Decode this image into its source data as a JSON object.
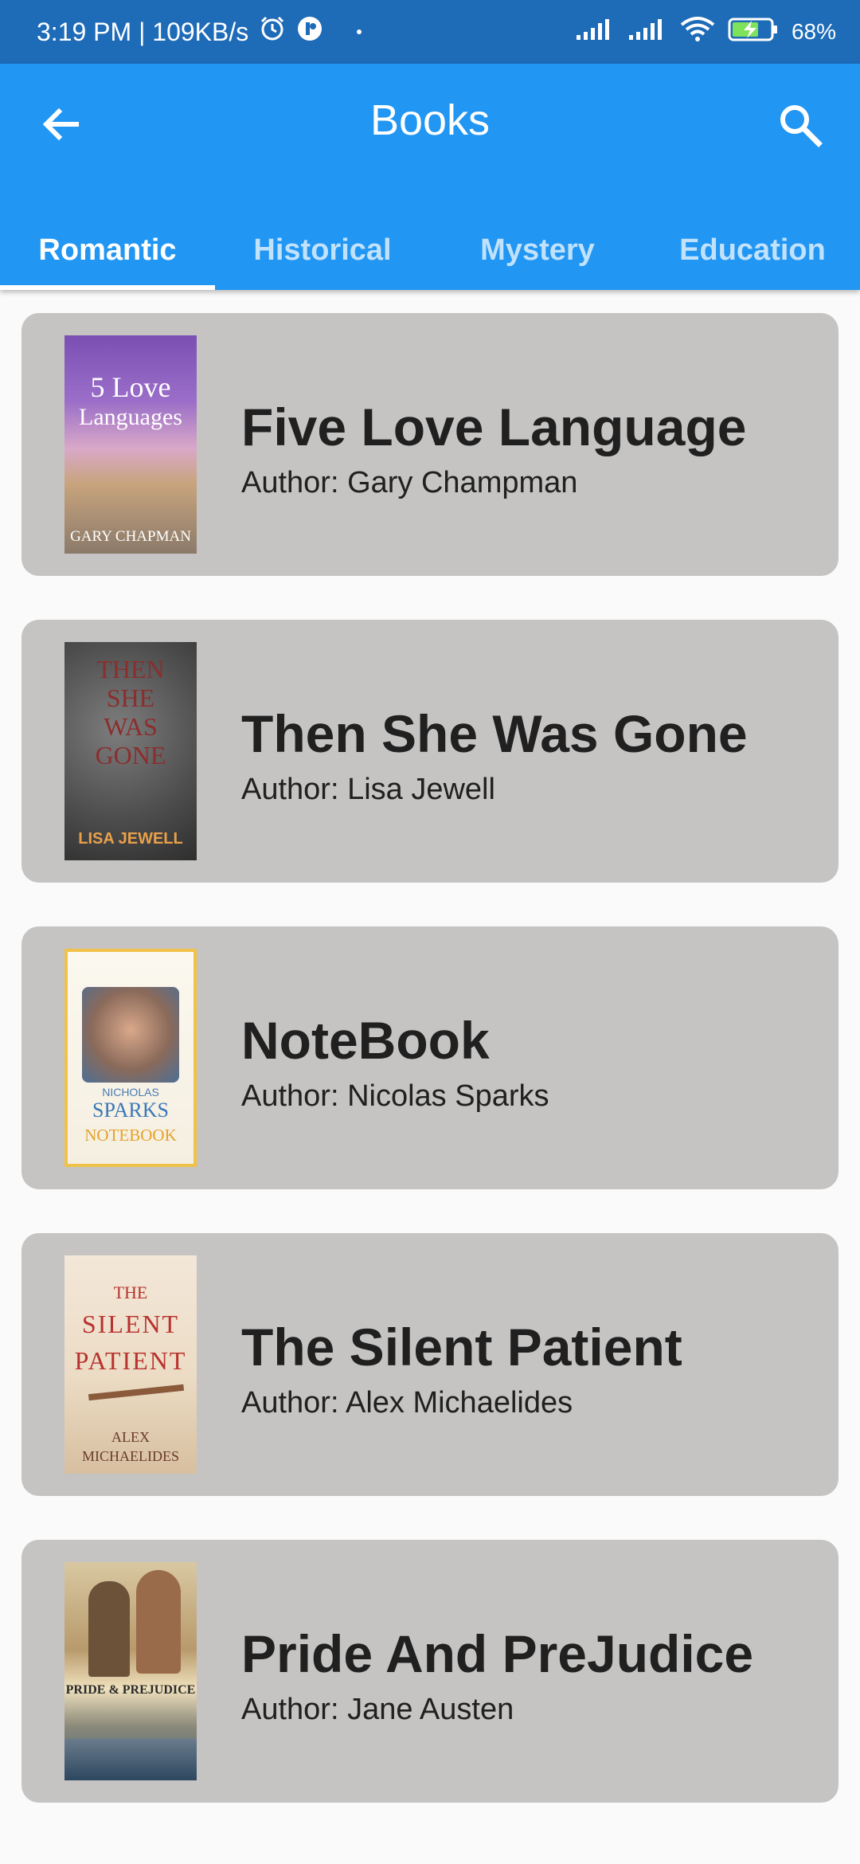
{
  "status_bar": {
    "time_speed": "3:19 PM | 109KB/s",
    "battery": "68%"
  },
  "app_bar": {
    "title": "Books",
    "back_icon": "arrow-back-icon",
    "search_icon": "search-icon"
  },
  "tabs": [
    {
      "label": "Romantic",
      "active": true
    },
    {
      "label": "Historical",
      "active": false
    },
    {
      "label": "Mystery",
      "active": false
    },
    {
      "label": "Education",
      "active": false
    }
  ],
  "books": [
    {
      "title": "Five Love Language",
      "author": "Author: Gary Champman",
      "cover_lines": [
        "5 Love",
        "Languages",
        "GARY CHAPMAN"
      ]
    },
    {
      "title": "Then She Was Gone",
      "author": "Author: Lisa Jewell",
      "cover_lines": [
        "THEN",
        "SHE",
        "WAS",
        "GONE",
        "LISA JEWELL"
      ]
    },
    {
      "title": "NoteBook",
      "author": "Author: Nicolas Sparks",
      "cover_lines": [
        "NICHOLAS",
        "SPARKS",
        "NOTEBOOK"
      ]
    },
    {
      "title": "The Silent Patient",
      "author": "Author: Alex Michaelides",
      "cover_lines": [
        "THE",
        "SILENT",
        "PATIENT",
        "ALEX",
        "MICHAELIDES"
      ]
    },
    {
      "title": "Pride And PreJudice",
      "author": "Author: Jane Austen",
      "cover_lines": [
        "PRIDE & PREJUDICE"
      ]
    }
  ],
  "colors": {
    "status_bar": "#1e6bb8",
    "app_bar": "#2196f3",
    "card": "#c5c4c3",
    "background": "#fafafa"
  }
}
